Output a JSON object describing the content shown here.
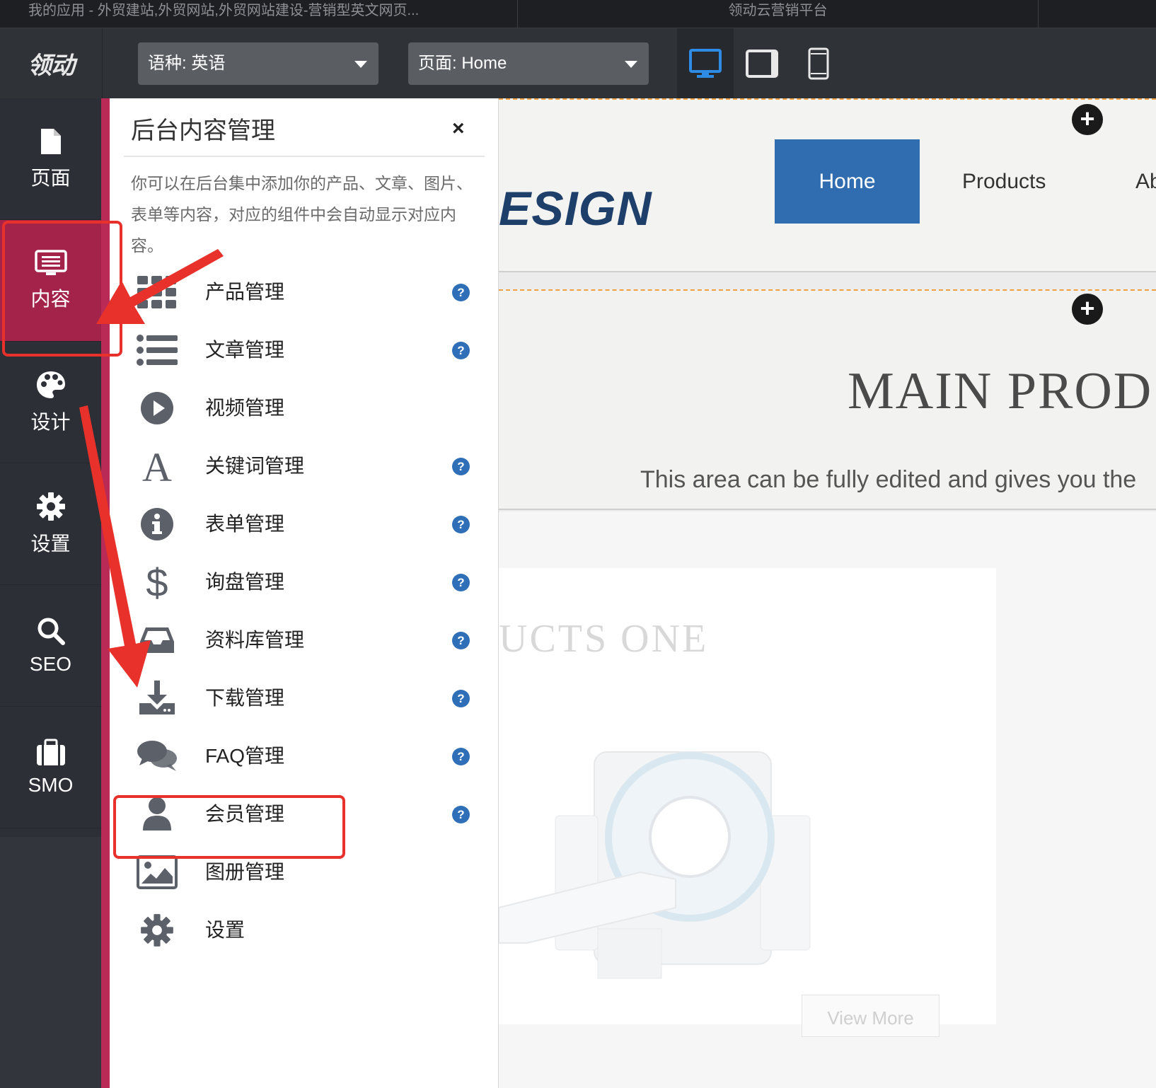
{
  "browser": {
    "tab1_title": "我的应用 - 外贸建站,外贸网站,外贸网站建设-营销型英文网页...",
    "tab2_title": "领动云营销平台"
  },
  "toolbar": {
    "logo_text": "领动",
    "language_select": "语种:  英语",
    "page_select": "页面:  Home",
    "devices": [
      "desktop-icon",
      "tablet-icon",
      "phone-icon"
    ],
    "active_device": "desktop"
  },
  "sidebar": {
    "items": [
      {
        "label": "页面",
        "icon": "page-icon"
      },
      {
        "label": "内容",
        "icon": "content-icon",
        "active": true
      },
      {
        "label": "设计",
        "icon": "palette-icon"
      },
      {
        "label": "设置",
        "icon": "gear-icon"
      },
      {
        "label": "SEO",
        "icon": "search-icon"
      },
      {
        "label": "SMO",
        "icon": "briefcase-icon"
      }
    ]
  },
  "panel": {
    "title": "后台内容管理",
    "close": "×",
    "description": "你可以在后台集中添加你的产品、文章、图片、表单等内容，对应的组件中会自动显示对应内容。",
    "items": [
      {
        "label": "产品管理",
        "icon": "grid-icon",
        "help": true
      },
      {
        "label": "文章管理",
        "icon": "list-icon",
        "help": true
      },
      {
        "label": "视频管理",
        "icon": "play-icon",
        "help": false
      },
      {
        "label": "关键词管理",
        "icon": "letter-a-icon",
        "help": true
      },
      {
        "label": "表单管理",
        "icon": "info-icon",
        "help": true
      },
      {
        "label": "询盘管理",
        "icon": "dollar-icon",
        "help": true
      },
      {
        "label": "资料库管理",
        "icon": "inbox-icon",
        "help": true
      },
      {
        "label": "下载管理",
        "icon": "download-icon",
        "help": true
      },
      {
        "label": "FAQ管理",
        "icon": "comments-icon",
        "help": true
      },
      {
        "label": "会员管理",
        "icon": "user-icon",
        "help": true,
        "highlighted": true
      },
      {
        "label": "图册管理",
        "icon": "image-icon",
        "help": false
      },
      {
        "label": "设置",
        "icon": "gear-icon",
        "help": false
      }
    ],
    "help_glyph": "?"
  },
  "preview": {
    "brand_partial": "ESIGN",
    "nav": [
      "Home",
      "Products",
      "Ab"
    ],
    "add_glyph": "+",
    "section_title": "MAIN PROD",
    "section_subtitle": "This area can be fully edited and gives you the",
    "card_title": "UCTS ONE",
    "view_more": "View More"
  },
  "colors": {
    "accent": "#a3234b",
    "active_nav_button": "#2f6cb0",
    "help_icon": "#2f6fb7",
    "annotation": "#e8312a",
    "dashed_border": "#f0a040"
  }
}
